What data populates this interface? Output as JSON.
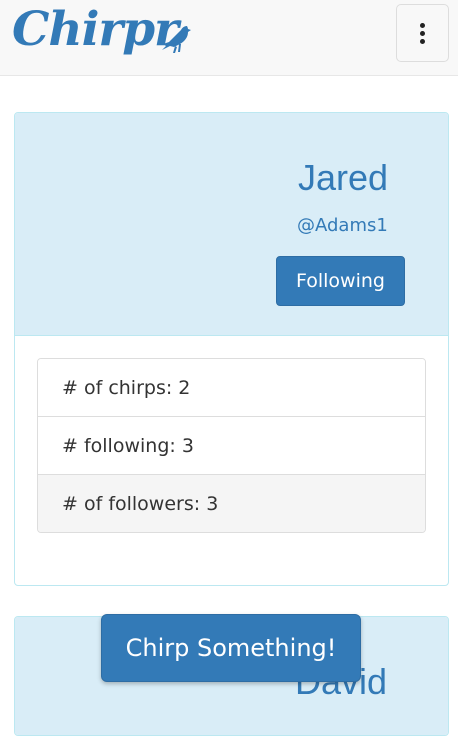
{
  "navbar": {
    "brand": "Chirpr",
    "brand_icon": "bird-icon",
    "menu_icon": "kebab-menu-icon"
  },
  "profiles": [
    {
      "name": "Jared",
      "handle": "@Adams1",
      "follow_label": "Following",
      "stats": [
        "# of chirps: 2",
        "# following: 3",
        "# of followers: 3"
      ]
    },
    {
      "name": "David"
    }
  ],
  "chirp_button": "Chirp Something!",
  "colors": {
    "primary": "#337ab7",
    "panel_heading": "#d9edf7",
    "panel_border": "#bce8f1",
    "navbar_bg": "#f8f8f8"
  }
}
